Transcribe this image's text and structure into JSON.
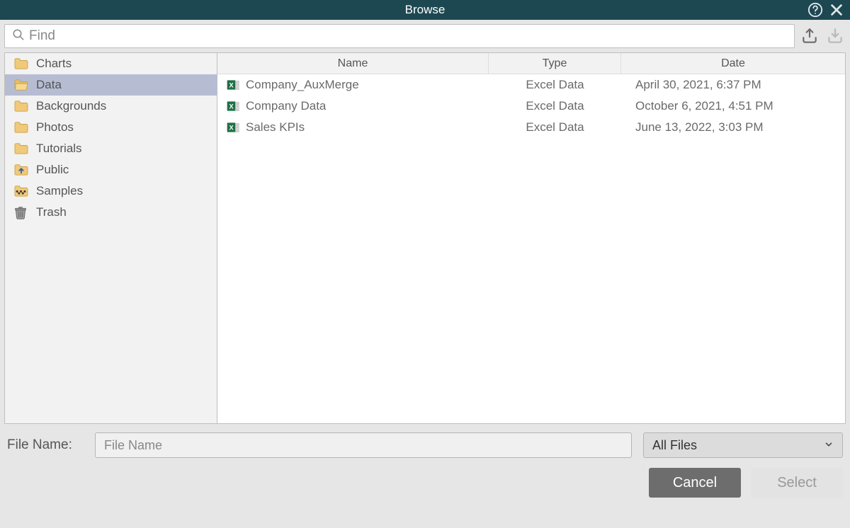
{
  "title": "Browse",
  "search": {
    "placeholder": "Find"
  },
  "sidebar": {
    "items": [
      {
        "label": "Charts",
        "icon": "folder",
        "selected": false
      },
      {
        "label": "Data",
        "icon": "folder-open",
        "selected": true
      },
      {
        "label": "Backgrounds",
        "icon": "folder",
        "selected": false
      },
      {
        "label": "Photos",
        "icon": "folder",
        "selected": false
      },
      {
        "label": "Tutorials",
        "icon": "folder",
        "selected": false
      },
      {
        "label": "Public",
        "icon": "folder-up",
        "selected": false
      },
      {
        "label": "Samples",
        "icon": "folder-pattern",
        "selected": false
      },
      {
        "label": "Trash",
        "icon": "trash",
        "selected": false
      }
    ]
  },
  "columns": {
    "name": "Name",
    "type": "Type",
    "date": "Date"
  },
  "files": [
    {
      "name": "Company_AuxMerge",
      "type": "Excel Data",
      "date": "April 30, 2021, 6:37 PM"
    },
    {
      "name": "Company Data",
      "type": "Excel Data",
      "date": "October 6, 2021, 4:51 PM"
    },
    {
      "name": "Sales KPIs",
      "type": "Excel Data",
      "date": "June 13, 2022, 3:03 PM"
    }
  ],
  "footer": {
    "filename_label": "File Name:",
    "filename_placeholder": "File Name",
    "filetype_selected": "All Files",
    "cancel": "Cancel",
    "select": "Select"
  }
}
